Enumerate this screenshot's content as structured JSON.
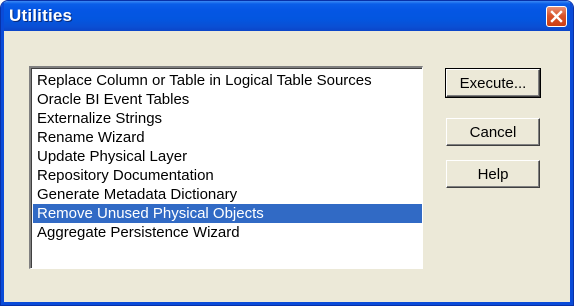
{
  "window": {
    "title": "Utilities",
    "close_icon": "close-icon"
  },
  "list": {
    "selected_index": 7,
    "items": [
      "Replace Column or Table in Logical Table Sources",
      "Oracle BI Event Tables",
      "Externalize Strings",
      "Rename Wizard",
      "Update Physical Layer",
      "Repository Documentation",
      "Generate Metadata Dictionary",
      "Remove Unused Physical Objects",
      "Aggregate Persistence Wizard"
    ]
  },
  "buttons": {
    "execute": "Execute...",
    "cancel": "Cancel",
    "help": "Help"
  },
  "colors": {
    "title_bar": "#0556e4",
    "selection": "#316ac5",
    "dialog_face": "#ece9d8",
    "close_button": "#d9542b"
  }
}
